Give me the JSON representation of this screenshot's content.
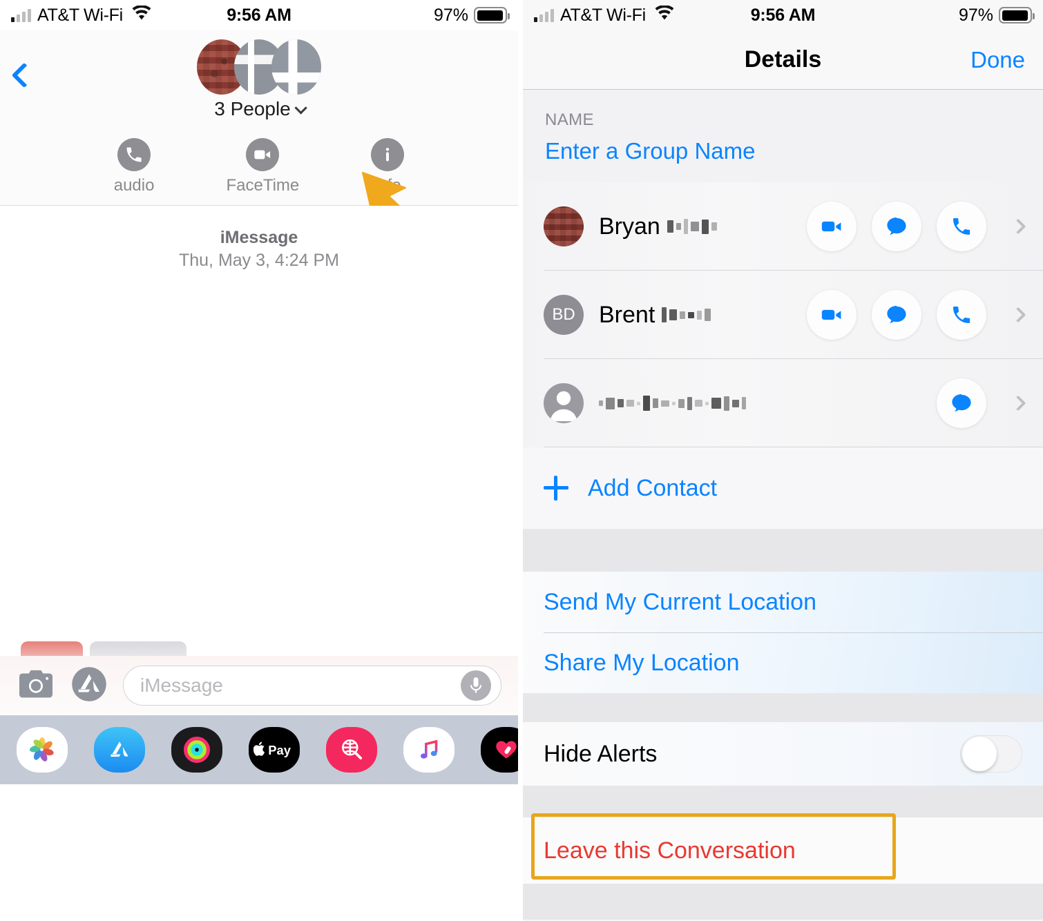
{
  "status_bar": {
    "carrier": "AT&T Wi-Fi",
    "time": "9:56 AM",
    "battery_percent": "97%",
    "wifi_icon": "wifi-icon",
    "signal_icon": "signal-bars-icon",
    "battery_icon": "battery-icon"
  },
  "left_panel": {
    "back_icon": "back-chevron-icon",
    "participants_label": "3 People",
    "participants_caret_icon": "chevron-down-icon",
    "avatars": [
      {
        "name": "avatar-blurred-1",
        "type": "pixelated-photo"
      },
      {
        "name": "avatar-blurred-2",
        "type": "pixelated-photo"
      },
      {
        "name": "avatar-blurred-3",
        "type": "pixelated-photo"
      }
    ],
    "actions": [
      {
        "label": "audio",
        "icon": "phone-icon"
      },
      {
        "label": "FaceTime",
        "icon": "video-camera-icon"
      },
      {
        "label": "info",
        "icon": "info-icon"
      }
    ],
    "conversation": {
      "service": "iMessage",
      "timestamp": "Thu, May 3, 4:24 PM"
    },
    "input_bar": {
      "camera_icon": "camera-icon",
      "apps_icon": "app-store-icon",
      "placeholder": "iMessage",
      "mic_icon": "microphone-icon"
    },
    "dock": [
      {
        "name": "photos-app-icon"
      },
      {
        "name": "app-store-app-icon"
      },
      {
        "name": "activity-rings-app-icon"
      },
      {
        "name": "apple-pay-app-icon"
      },
      {
        "name": "gif-search-app-icon"
      },
      {
        "name": "apple-music-app-icon"
      },
      {
        "name": "heart-digital-touch-app-icon"
      }
    ],
    "annotation": {
      "arrow_color": "#f0a81c",
      "points_to": "info"
    }
  },
  "right_panel": {
    "nav": {
      "title": "Details",
      "done_label": "Done"
    },
    "name_section": {
      "header": "NAME",
      "group_name_placeholder": "Enter a Group Name"
    },
    "contacts": [
      {
        "first_name": "Bryan",
        "redacted_last_name": true,
        "avatar_type": "photo",
        "avatar_initials": "",
        "actions": [
          "video-icon",
          "message-icon",
          "phone-icon"
        ],
        "chevron": "chevron-right-icon"
      },
      {
        "first_name": "Brent",
        "redacted_last_name": true,
        "avatar_type": "initials",
        "avatar_initials": "BD",
        "actions": [
          "video-icon",
          "message-icon",
          "phone-icon"
        ],
        "chevron": "chevron-right-icon"
      },
      {
        "first_name": "",
        "redacted_last_name": true,
        "avatar_type": "placeholder-person",
        "avatar_initials": "",
        "actions": [
          "message-icon"
        ],
        "chevron": "chevron-right-icon"
      }
    ],
    "add_contact": {
      "label": "Add Contact",
      "icon": "plus-icon"
    },
    "location": {
      "send_current": "Send My Current Location",
      "share": "Share My Location"
    },
    "hide_alerts": {
      "label": "Hide Alerts",
      "toggle_state": "off"
    },
    "leave": {
      "label": "Leave this Conversation",
      "text_color": "#e8392f",
      "highlight_color": "#e8a61c"
    }
  }
}
